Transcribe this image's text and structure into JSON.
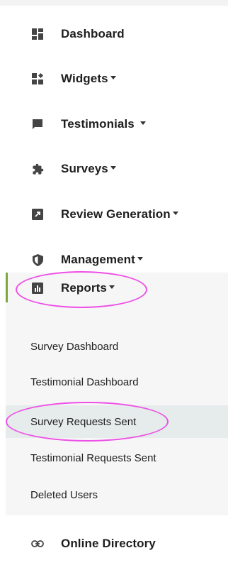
{
  "sidebar": {
    "items": [
      {
        "label": "Dashboard",
        "icon": "dashboard-icon",
        "caret": false
      },
      {
        "label": "Widgets",
        "icon": "widgets-icon",
        "caret": true
      },
      {
        "label": "Testimonials",
        "icon": "chat-bubble-icon",
        "caret": true
      },
      {
        "label": "Surveys",
        "icon": "puzzle-icon",
        "caret": true
      },
      {
        "label": "Review Generation",
        "icon": "external-link-icon",
        "caret": true
      },
      {
        "label": "Management",
        "icon": "shield-icon",
        "caret": true
      },
      {
        "label": "Reports",
        "icon": "bar-chart-icon",
        "caret": true
      },
      {
        "label": "Online Directory",
        "icon": "link-icon",
        "caret": false
      }
    ],
    "reports_submenu": [
      {
        "label": "Survey Dashboard"
      },
      {
        "label": "Testimonial Dashboard"
      },
      {
        "label": "Survey Requests Sent"
      },
      {
        "label": "Testimonial Requests Sent"
      },
      {
        "label": "Deleted Users"
      }
    ]
  },
  "colors": {
    "active_bar": "#7ea83c",
    "highlight_ellipse": "#ee4fe6",
    "selected_row": "#e6ebeb",
    "submenu_bg": "#f6f6f6"
  }
}
